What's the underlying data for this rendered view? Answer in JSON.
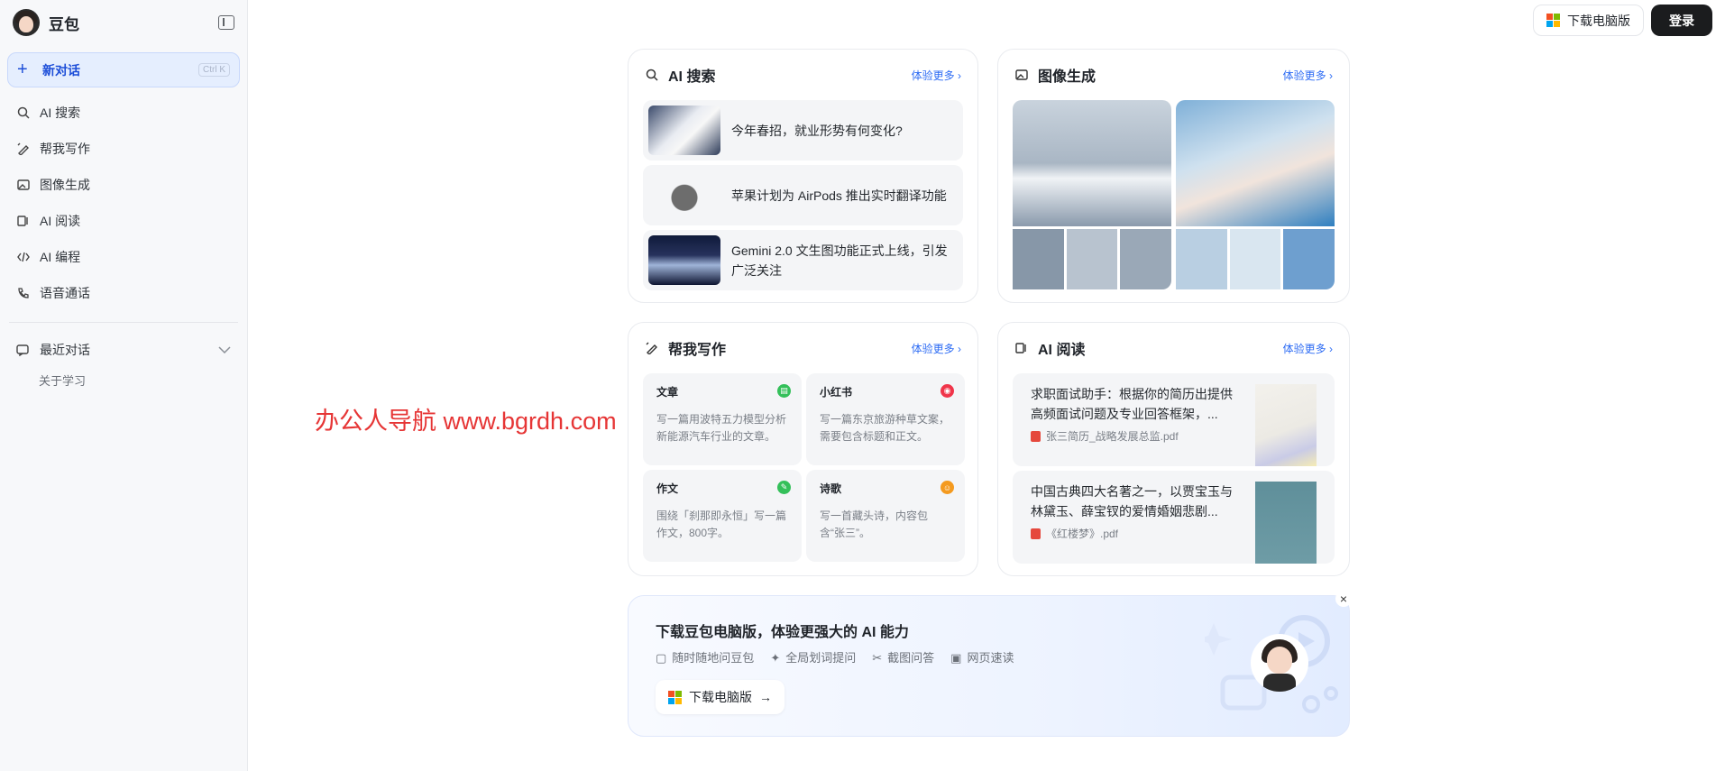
{
  "sidebar": {
    "brand": "豆包",
    "new_chat": {
      "label": "新对话",
      "shortcut": "Ctrl K"
    },
    "nav": [
      {
        "label": "AI 搜索",
        "icon": "search-icon"
      },
      {
        "label": "帮我写作",
        "icon": "pen-icon"
      },
      {
        "label": "图像生成",
        "icon": "image-icon"
      },
      {
        "label": "AI 阅读",
        "icon": "book-icon"
      },
      {
        "label": "AI 编程",
        "icon": "code-icon"
      },
      {
        "label": "语音通话",
        "icon": "phone-icon"
      }
    ],
    "recent": {
      "label": "最近对话",
      "items": [
        "关于学习"
      ]
    }
  },
  "header": {
    "download": "下载电脑版",
    "login": "登录"
  },
  "cards": {
    "search": {
      "title": "AI 搜索",
      "more": "体验更多 ›",
      "items": [
        "今年春招，就业形势有何变化?",
        "苹果计划为 AirPods 推出实时翻译功能",
        "Gemini 2.0 文生图功能正式上线，引发广泛关注"
      ]
    },
    "image": {
      "title": "图像生成",
      "more": "体验更多 ›"
    },
    "write": {
      "title": "帮我写作",
      "more": "体验更多 ›",
      "items": [
        {
          "title": "文章",
          "desc": "写一篇用波特五力模型分析新能源汽车行业的文章。",
          "color": "#34c05a"
        },
        {
          "title": "小红书",
          "desc": "写一篇东京旅游种草文案，需要包含标题和正文。",
          "color": "#f0354a"
        },
        {
          "title": "作文",
          "desc": "围绕「刹那即永恒」写一篇作文，800字。",
          "color": "#34c05a"
        },
        {
          "title": "诗歌",
          "desc": "写一首藏头诗，内容包含“张三”。",
          "color": "#f49a1f"
        }
      ]
    },
    "read": {
      "title": "AI 阅读",
      "more": "体验更多 ›",
      "items": [
        {
          "text": "求职面试助手：根据你的简历出提供高频面试问题及专业回答框架，...",
          "file": "张三简历_战略发展总监.pdf"
        },
        {
          "text": "中国古典四大名著之一，以贾宝玉与林黛玉、薛宝钗的爱情婚姻悲剧...",
          "file": "《红楼梦》.pdf"
        }
      ]
    }
  },
  "banner": {
    "title": "下载豆包电脑版，体验更强大的 AI 能力",
    "features": [
      "随时随地问豆包",
      "全局划词提问",
      "截图问答",
      "网页速读"
    ],
    "button": "下载电脑版",
    "close": "×"
  },
  "watermark": "办公人导航 www.bgrdh.com",
  "colors": {
    "accent": "#2c6bf4",
    "login_bg": "#1b1c1e"
  }
}
